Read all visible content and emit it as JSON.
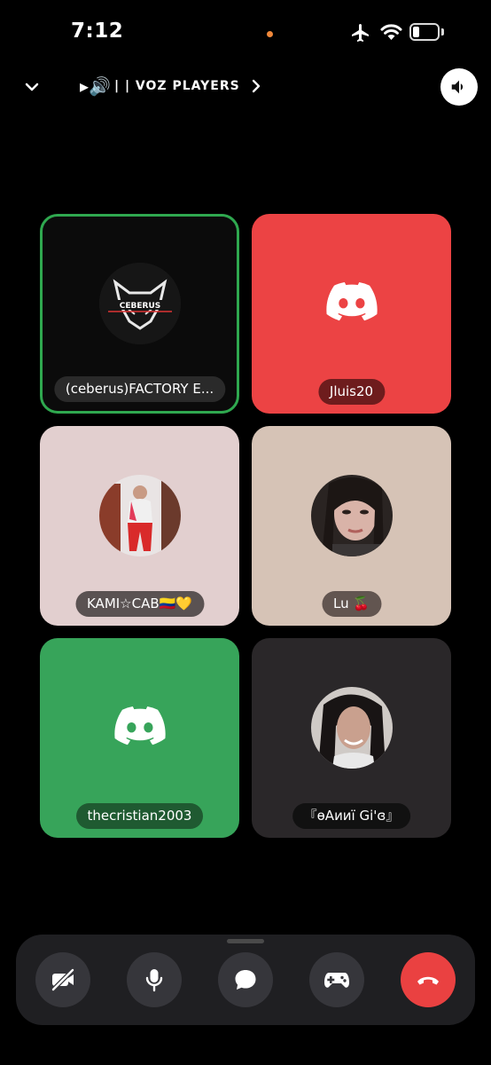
{
  "status_bar": {
    "time": "7:12"
  },
  "header": {
    "channel_prefix": "▸🔊",
    "channel_name": "| | VOZ PLAYERS"
  },
  "participants": [
    {
      "name": "(ceberus)FACTORY E...",
      "tile_color": "#0b0b0b",
      "speaking": true,
      "avatar": "ceberus-logo-avatar",
      "avatar_text": "CEBERUS"
    },
    {
      "name": "Jluis20",
      "tile_color": "#ec4344",
      "speaking": false,
      "avatar": "discord-logo-icon"
    },
    {
      "name": "KAMI☆CAB🇨🇴💛",
      "tile_color": "#e2cfcf",
      "speaking": false,
      "avatar": "photo-avatar"
    },
    {
      "name": "Lu 🍒",
      "tile_color": "#d6c3b6",
      "speaking": false,
      "avatar": "photo-avatar"
    },
    {
      "name": "thecristian2003",
      "tile_color": "#37a45a",
      "speaking": false,
      "avatar": "discord-logo-icon"
    },
    {
      "name": "『ɵAииï Gi'ɞ』",
      "tile_color": "#2a2729",
      "speaking": false,
      "avatar": "photo-avatar"
    }
  ],
  "controls": [
    {
      "name": "camera-off-button",
      "icon": "camera-off-icon"
    },
    {
      "name": "microphone-button",
      "icon": "microphone-icon"
    },
    {
      "name": "chat-button",
      "icon": "chat-bubble-icon"
    },
    {
      "name": "activities-button",
      "icon": "gamepad-icon"
    },
    {
      "name": "end-call-button",
      "icon": "phone-hangup-icon",
      "color": "#ea4141"
    }
  ],
  "colors": {
    "speaking_border": "#2fa84f",
    "end_call": "#ea4141",
    "control_bg": "#36363b"
  }
}
